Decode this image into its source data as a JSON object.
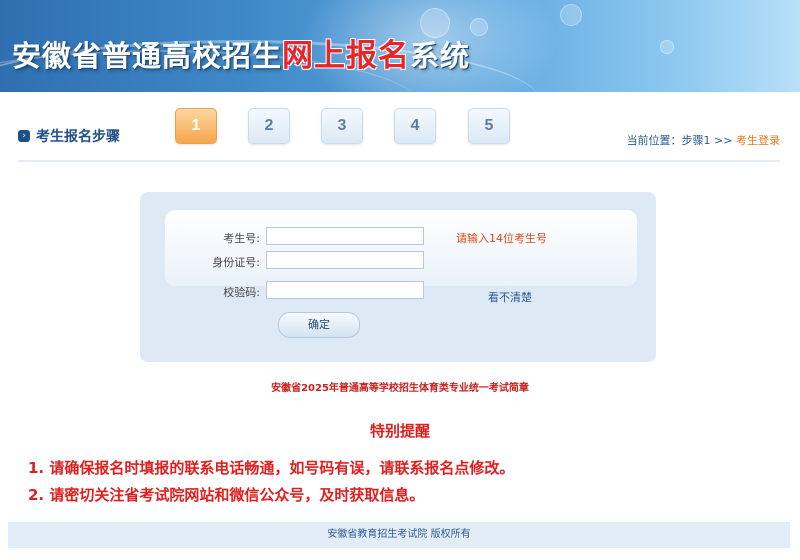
{
  "header": {
    "title_part1": "安徽省普通高校招生",
    "title_highlight": "网上报名",
    "title_part2": "系统"
  },
  "steps": {
    "label": "考生报名步骤",
    "items": [
      "1",
      "2",
      "3",
      "4",
      "5"
    ],
    "active": "1"
  },
  "location": {
    "prefix": "当前位置：步骤1 >> ",
    "current": "考生登录"
  },
  "form": {
    "exam_no_label": "考生号:",
    "exam_no_value": "",
    "exam_no_hint": "请输入14位考生号",
    "id_label": "身份证号:",
    "id_value": "",
    "captcha_label": "校验码:",
    "captcha_value": "",
    "captcha_refresh": "看不清楚",
    "submit_label": "确定"
  },
  "notice_link": "安徽省2025年普通高等学校招生体育类专业统一考试简章",
  "special_notice": {
    "title": "特别提醒",
    "lines": [
      "1. 请确保报名时填报的联系电话畅通，如号码有误，请联系报名点修改。",
      "2. 请密切关注省考试院网站和微信公众号，及时获取信息。"
    ]
  },
  "footer": "安徽省教育招生考试院 版权所有",
  "colors": {
    "accent": "#1f4f86",
    "alert": "#e02020",
    "active_step": "#f5a64a"
  }
}
